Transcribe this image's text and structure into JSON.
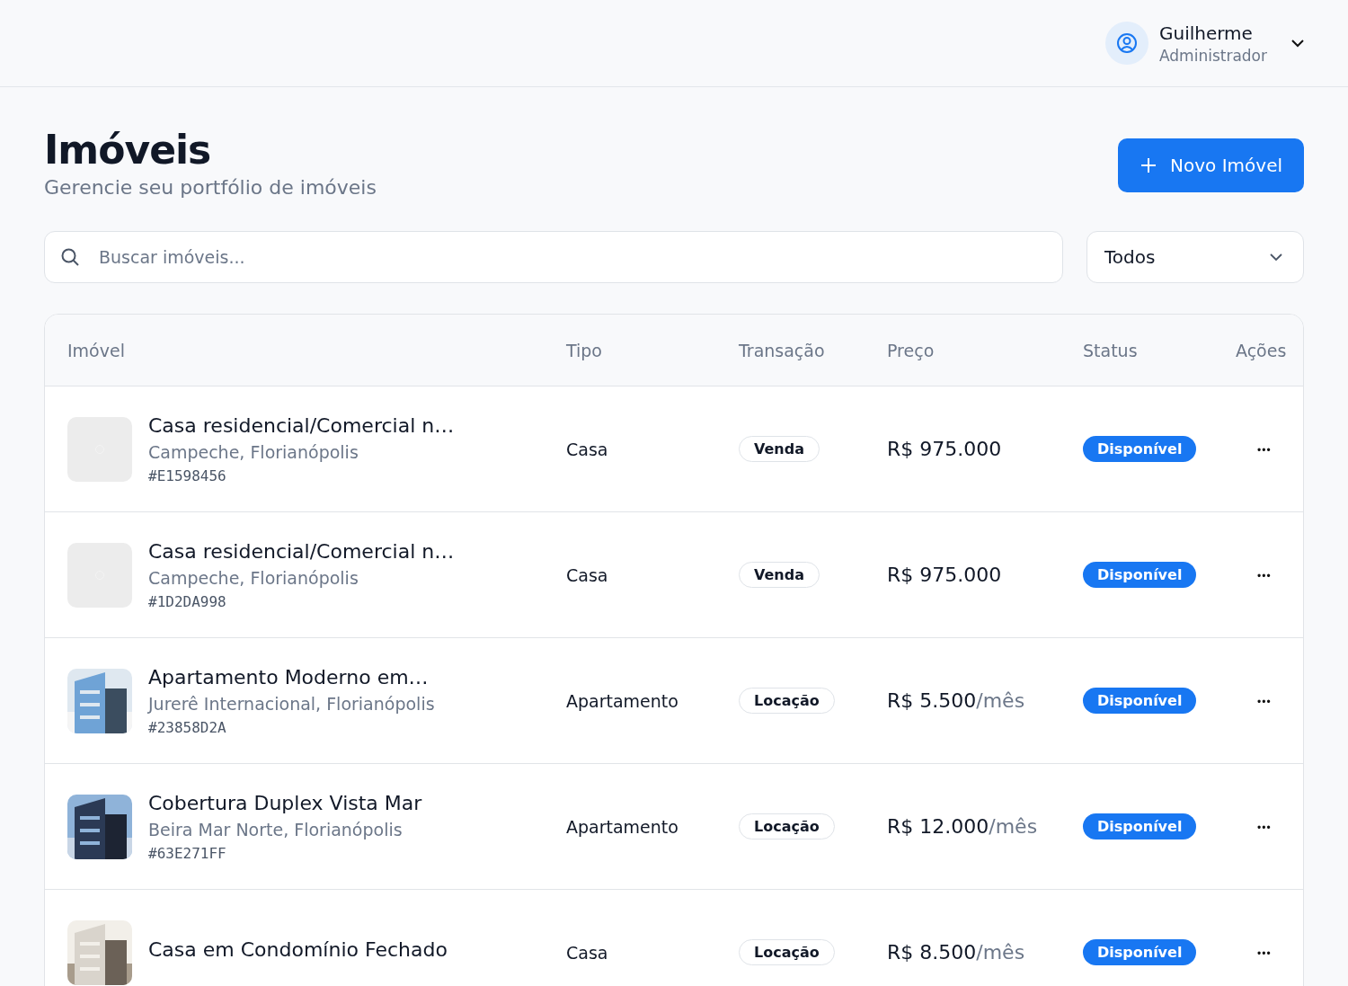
{
  "user": {
    "name": "Guilherme",
    "role": "Administrador"
  },
  "page": {
    "title": "Imóveis",
    "subtitle": "Gerencie seu portfólio de imóveis",
    "new_button": "Novo Imóvel"
  },
  "search": {
    "placeholder": "Buscar imóveis..."
  },
  "filter": {
    "value": "Todos"
  },
  "table": {
    "columns": [
      "Imóvel",
      "Tipo",
      "Transação",
      "Preço",
      "Status",
      "Ações"
    ],
    "rows": [
      {
        "thumb": {
          "kind": "placeholder"
        },
        "title": "Casa residencial/Comercial n…",
        "location": "Campeche, Florianópolis",
        "code": "#E1598456",
        "type": "Casa",
        "transaction": "Venda",
        "price": "R$ 975.000",
        "status": "Disponível",
        "actions": "•••"
      },
      {
        "thumb": {
          "kind": "placeholder"
        },
        "title": "Casa residencial/Comercial n…",
        "location": "Campeche, Florianópolis",
        "code": "#1D2DA998",
        "type": "Casa",
        "transaction": "Venda",
        "price": "R$ 975.000",
        "status": "Disponível",
        "actions": "•••"
      },
      {
        "title": "Apartamento Moderno em…",
        "location": "Jurerê Internacional, Florianópolis",
        "code": "#23858D2A",
        "type": "Apartamento",
        "transaction": "Locação",
        "price": "R$ 5.500",
        "price_suffix": "/mês",
        "status": "Disponível",
        "actions": "•••"
      },
      {
        "title": "Cobertura Duplex Vista Mar",
        "location": "Beira Mar Norte, Florianópolis",
        "code": "#63E271FF",
        "type": "Apartamento",
        "transaction": "Locação",
        "price": "R$ 12.000",
        "price_suffix": "/mês",
        "status": "Disponível",
        "actions": "•••"
      },
      {
        "title": "Casa em Condomínio Fechado",
        "type": "Casa",
        "transaction": "Locação",
        "price": "R$ 8.500",
        "price_suffix": "/mês",
        "status": "Disponível",
        "actions": "•••"
      }
    ]
  }
}
